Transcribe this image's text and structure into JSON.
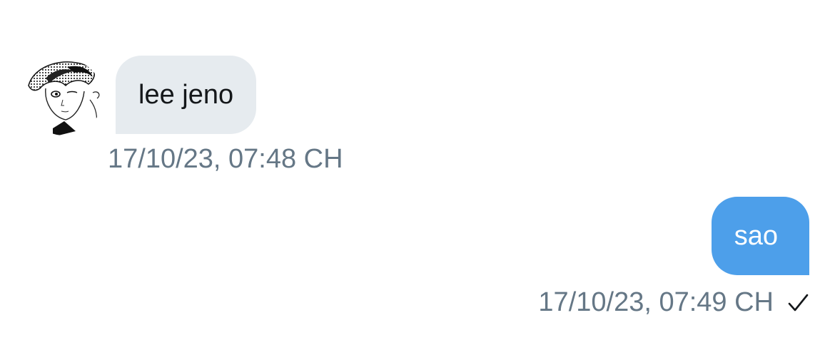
{
  "conversation": {
    "messages": [
      {
        "direction": "received",
        "text": "lee jeno",
        "timestamp": "17/10/23, 07:48 CH",
        "avatar_icon": "profile-avatar"
      },
      {
        "direction": "sent",
        "text": "sao",
        "timestamp": "17/10/23, 07:49 CH",
        "status_icon": "check-icon"
      }
    ]
  },
  "colors": {
    "received_bubble": "#e6ebef",
    "sent_bubble": "#4d9fea",
    "timestamp_text": "#657786"
  }
}
